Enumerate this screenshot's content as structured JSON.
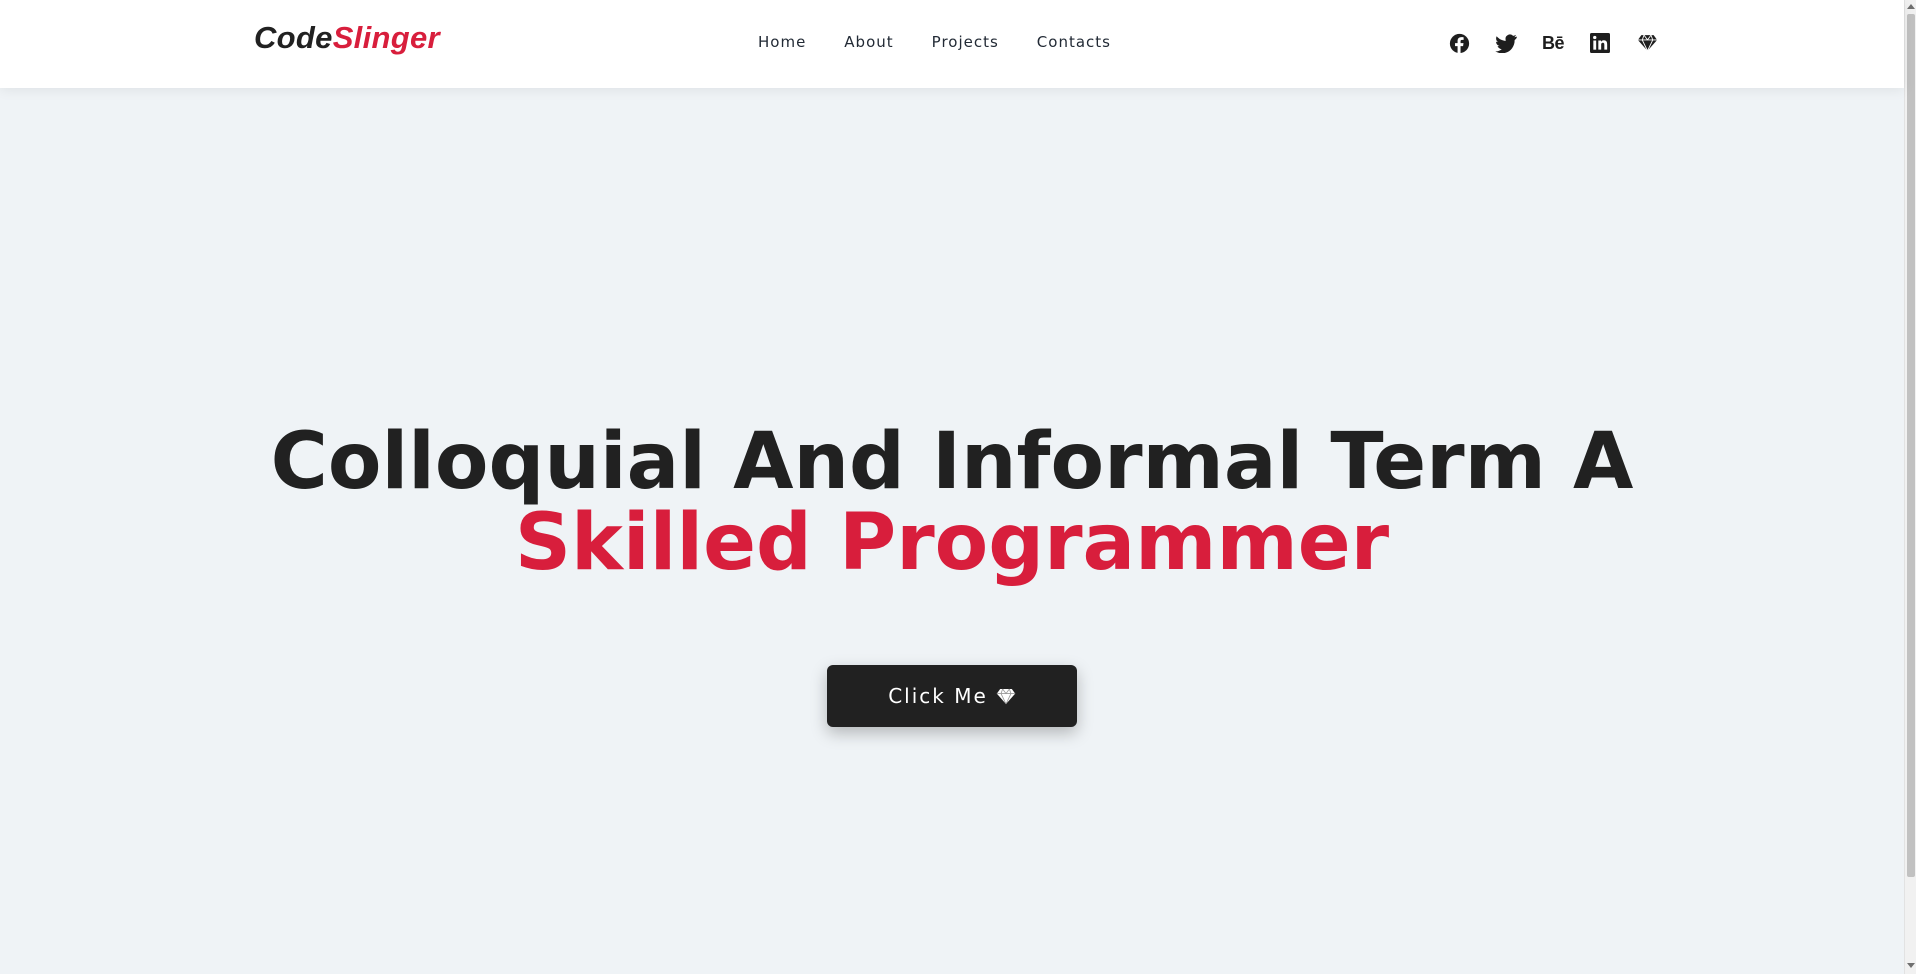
{
  "header": {
    "logo": {
      "part1": "Code",
      "part2": "Slinger"
    },
    "nav": [
      {
        "label": "Home"
      },
      {
        "label": "About"
      },
      {
        "label": "Projects"
      },
      {
        "label": "Contacts"
      }
    ],
    "social": [
      {
        "icon": "facebook-icon"
      },
      {
        "icon": "twitter-icon"
      },
      {
        "icon": "behance-icon",
        "text": "Bē"
      },
      {
        "icon": "linkedin-icon"
      },
      {
        "icon": "gem-icon"
      }
    ]
  },
  "hero": {
    "title_line1": "Colloquial And Informal Term A",
    "title_line2": "Skilled Programmer",
    "cta_label": "Click Me",
    "cta_icon": "gem-icon"
  },
  "colors": {
    "accent": "#d81e3c",
    "dark": "#212121",
    "background": "#eff3f6",
    "header_bg": "#ffffff"
  }
}
